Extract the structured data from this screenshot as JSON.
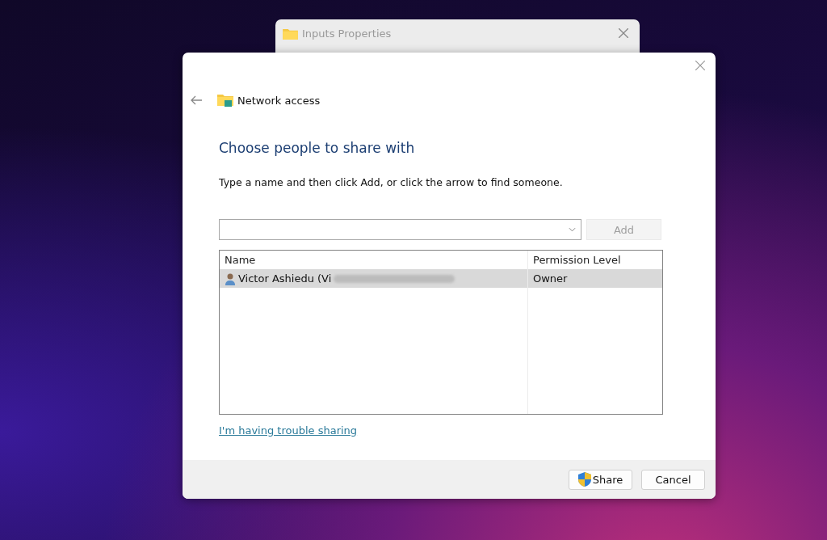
{
  "background_window": {
    "title": "Inputs Properties"
  },
  "dialog": {
    "title": "Network access",
    "heading": "Choose people to share with",
    "instruction": "Type a name and then click Add, or click the arrow to find someone.",
    "add_button": {
      "label": "Add",
      "disabled": true
    },
    "table": {
      "columns": [
        "Name",
        "Permission Level"
      ],
      "rows": [
        {
          "name": "Victor Ashiedu (Vi",
          "permission": "Owner",
          "selected": true
        }
      ]
    },
    "help_link": "I'm having trouble sharing",
    "buttons": [
      {
        "label": "Share",
        "kind": "shield"
      },
      {
        "label": "Cancel",
        "kind": "plain"
      }
    ]
  }
}
